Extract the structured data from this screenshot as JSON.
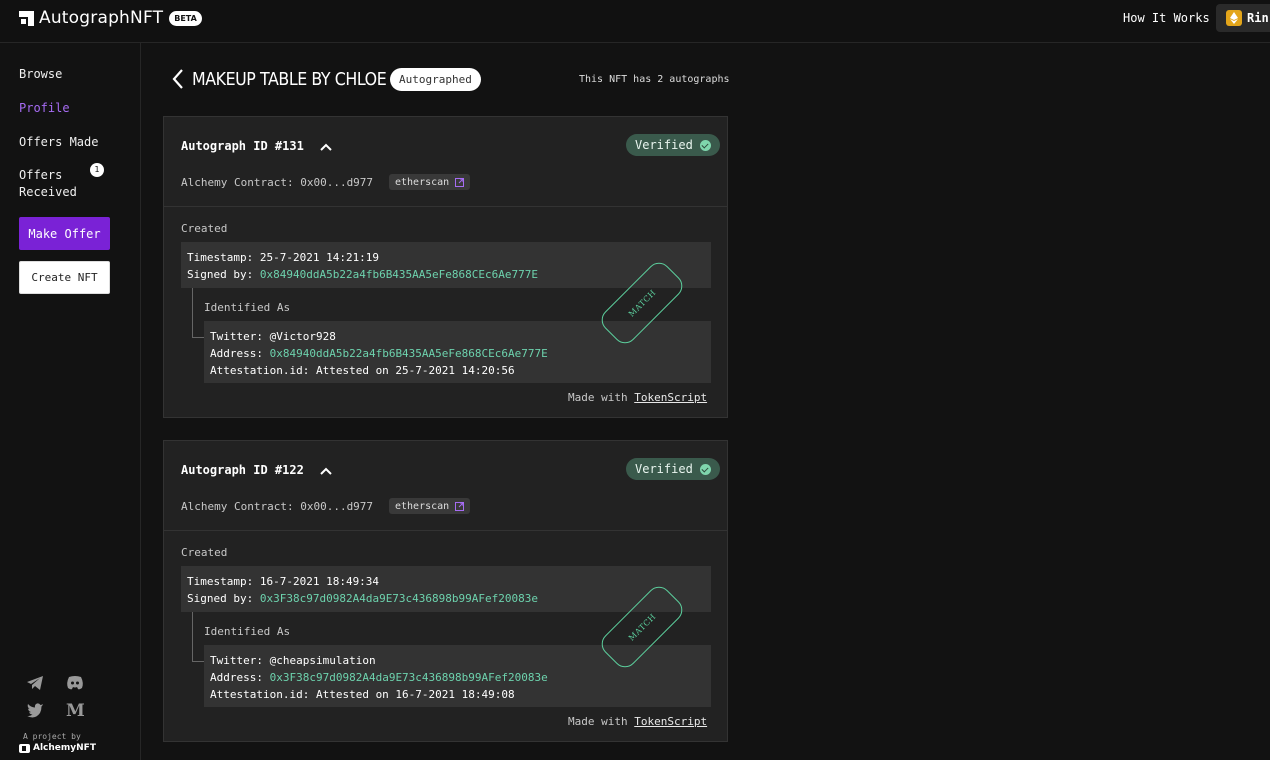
{
  "header": {
    "app_name": "AutographNFT",
    "beta_label": "BETA",
    "how_it_works": "How It Works",
    "network_label": "Rin"
  },
  "sidebar": {
    "items": [
      {
        "label": "Browse"
      },
      {
        "label": "Profile",
        "active": true
      },
      {
        "label": "Offers Made"
      },
      {
        "label": "Offers Received",
        "badge": "1"
      }
    ],
    "make_offer": "Make Offer",
    "create_nft": "Create NFT",
    "social_icons": [
      "telegram-icon",
      "discord-icon",
      "twitter-icon",
      "medium-icon"
    ],
    "project_by": "A project by",
    "project_name": "AlchemyNFT"
  },
  "main": {
    "title": "MAKEUP TABLE BY CHLOE",
    "status": "Autographed",
    "autograph_count_text": "This NFT has 2 autographs",
    "cards": [
      {
        "autograph_id": "Autograph ID #131",
        "verified": "Verified",
        "contract": "Alchemy Contract: 0x00...d977",
        "etherscan": "etherscan",
        "created_label": "Created",
        "timestamp": "Timestamp: 25-7-2021 14:21:19",
        "signed_by_label": "Signed by: ",
        "signed_by": "0x84940ddA5b22a4fb6B435AA5eFe868CEc6Ae777E",
        "identified_label": "Identified As",
        "twitter": "Twitter: @Victor928",
        "address_label": "Address: ",
        "address": "0x84940ddA5b22a4fb6B435AA5eFe868CEc6Ae777E",
        "attestation": "Attestation.id: Attested on 25-7-2021 14:20:56",
        "made_with": "Made with ",
        "tokenscript": "TokenScript",
        "stamp": "MATCH"
      },
      {
        "autograph_id": "Autograph ID #122",
        "verified": "Verified",
        "contract": "Alchemy Contract: 0x00...d977",
        "etherscan": "etherscan",
        "created_label": "Created",
        "timestamp": "Timestamp: 16-7-2021 18:49:34",
        "signed_by_label": "Signed by: ",
        "signed_by": "0x3F38c97d0982A4da9E73c436898b99AFef20083e",
        "identified_label": "Identified As",
        "twitter": "Twitter: @cheapsimulation",
        "address_label": "Address: ",
        "address": "0x3F38c97d0982A4da9E73c436898b99AFef20083e",
        "attestation": "Attestation.id: Attested on 16-7-2021 18:49:08",
        "made_with": "Made with ",
        "tokenscript": "TokenScript",
        "stamp": "MATCH"
      }
    ]
  },
  "colors": {
    "accent_purple": "#7a22d6",
    "active_nav": "#a66cf3",
    "address_green": "#6dd2ad",
    "verified_bg": "#3a5a4c",
    "network_badge": "#e3a51a"
  }
}
